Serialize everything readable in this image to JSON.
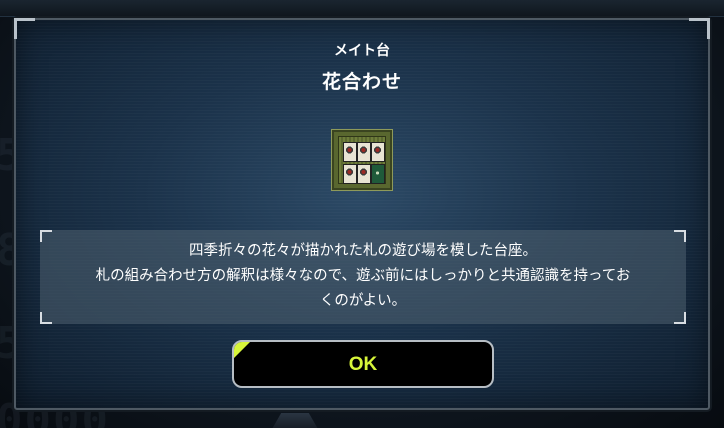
{
  "modal": {
    "subtitle": "メイト台",
    "title": "花合わせ",
    "item_image": "hanafuda-mat-icon",
    "description": "四季折々の花々が描かれた札の遊び場を模した台座。\n札の組み合わせ方の解釈は様々なので、遊ぶ前にはしっかりと共通認識を持ってお\nくのがよい。",
    "ok_label": "OK"
  },
  "colors": {
    "accent": "#d7f53a",
    "modal_bg": "#1b324a",
    "button_bg": "#000000"
  }
}
